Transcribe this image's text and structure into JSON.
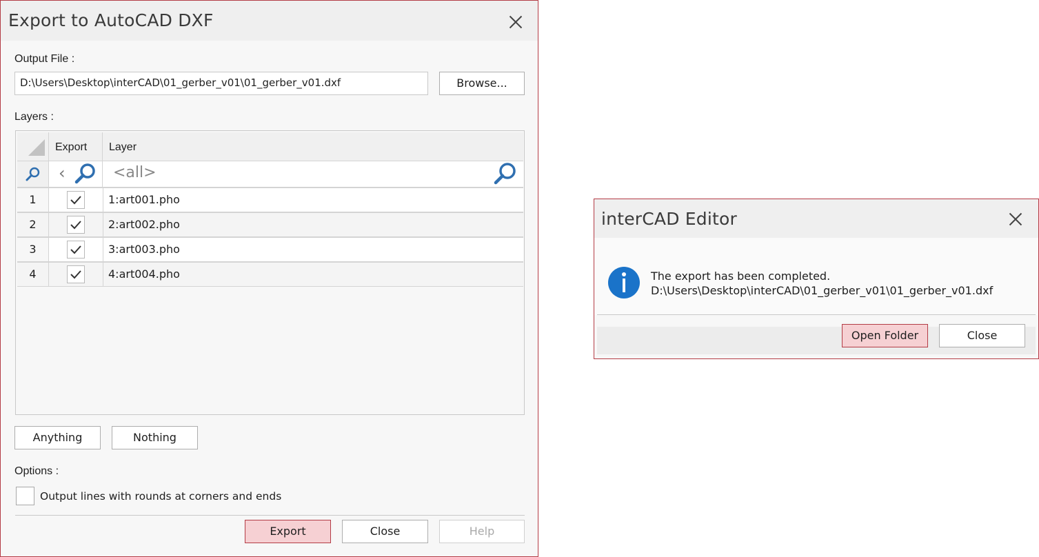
{
  "export_dialog": {
    "title": "Export to AutoCAD DXF",
    "output_file_label": "Output File :",
    "output_file_value": "D:\\Users\\Desktop\\interCAD\\01_gerber_v01\\01_gerber_v01.dxf",
    "browse_label": "Browse...",
    "layers_label": "Layers :",
    "columns": {
      "export": "Export",
      "layer": "Layer"
    },
    "filter_all": "<all>",
    "rows": [
      {
        "num": "1",
        "checked": true,
        "layer": "1:art001.pho"
      },
      {
        "num": "2",
        "checked": true,
        "layer": "2:art002.pho"
      },
      {
        "num": "3",
        "checked": true,
        "layer": "3:art003.pho"
      },
      {
        "num": "4",
        "checked": true,
        "layer": "4:art004.pho"
      }
    ],
    "anything_label": "Anything",
    "nothing_label": "Nothing",
    "options_label": "Options :",
    "round_option_label": "Output lines with rounds at corners and ends",
    "round_option_checked": false,
    "export_label": "Export",
    "close_label": "Close",
    "help_label": "Help"
  },
  "message_dialog": {
    "title": "interCAD Editor",
    "message_line1": "The export has been completed.",
    "message_line2": "D:\\Users\\Desktop\\interCAD\\01_gerber_v01\\01_gerber_v01.dxf",
    "open_folder_label": "Open Folder",
    "close_label": "Close"
  },
  "colors": {
    "accent_border": "#b33b45",
    "primary_button_fill": "#f6d0d3",
    "info_icon": "#1a73c9",
    "search_icon": "#2f6fb0"
  },
  "icons": [
    "close-icon",
    "search-icon",
    "check-icon",
    "info-icon"
  ]
}
